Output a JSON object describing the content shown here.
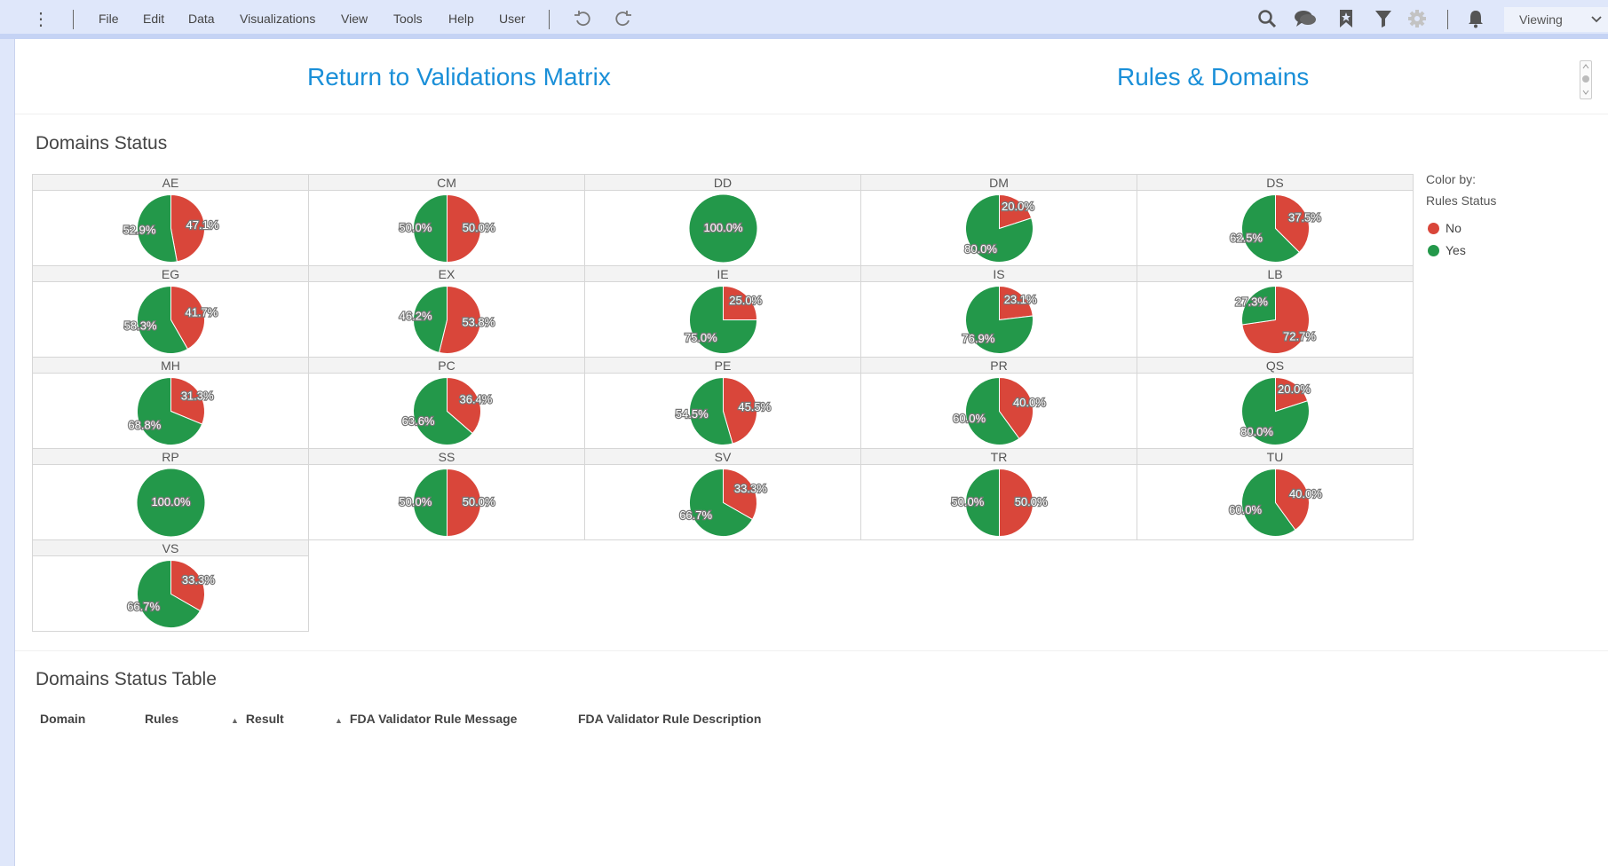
{
  "toolbar": {
    "menu": [
      "File",
      "Edit",
      "Data",
      "Visualizations",
      "View",
      "Tools",
      "Help",
      "User"
    ],
    "mode": "Viewing"
  },
  "header": {
    "return_link": "Return to Validations Matrix",
    "rules_link": "Rules & Domains"
  },
  "domains_status": {
    "title": "Domains Status",
    "legend": {
      "line1": "Color by:",
      "line2": "Rules Status",
      "items": [
        {
          "label": "No",
          "color": "#d9463a"
        },
        {
          "label": "Yes",
          "color": "#23984a"
        }
      ]
    }
  },
  "chart_data": {
    "type": "pie",
    "title": "Domains Status",
    "series_order": [
      "No",
      "Yes"
    ],
    "colors": {
      "No": "#d9463a",
      "Yes": "#23984a"
    },
    "panels": [
      {
        "domain": "AE",
        "no": 47.1,
        "yes": 52.9
      },
      {
        "domain": "CM",
        "no": 50.0,
        "yes": 50.0
      },
      {
        "domain": "DD",
        "no": 0,
        "yes": 100.0
      },
      {
        "domain": "DM",
        "no": 20.0,
        "yes": 80.0
      },
      {
        "domain": "DS",
        "no": 37.5,
        "yes": 62.5
      },
      {
        "domain": "EG",
        "no": 41.7,
        "yes": 58.3
      },
      {
        "domain": "EX",
        "no": 53.8,
        "yes": 46.2
      },
      {
        "domain": "IE",
        "no": 25.0,
        "yes": 75.0
      },
      {
        "domain": "IS",
        "no": 23.1,
        "yes": 76.9
      },
      {
        "domain": "LB",
        "no": 72.7,
        "yes": 27.3
      },
      {
        "domain": "MH",
        "no": 31.3,
        "yes": 68.8
      },
      {
        "domain": "PC",
        "no": 36.4,
        "yes": 63.6
      },
      {
        "domain": "PE",
        "no": 45.5,
        "yes": 54.5
      },
      {
        "domain": "PR",
        "no": 40.0,
        "yes": 60.0
      },
      {
        "domain": "QS",
        "no": 20.0,
        "yes": 80.0
      },
      {
        "domain": "RP",
        "no": 0,
        "yes": 100.0
      },
      {
        "domain": "SS",
        "no": 50.0,
        "yes": 50.0
      },
      {
        "domain": "SV",
        "no": 33.3,
        "yes": 66.7
      },
      {
        "domain": "TR",
        "no": 50.0,
        "yes": 50.0
      },
      {
        "domain": "TU",
        "no": 40.0,
        "yes": 60.0
      },
      {
        "domain": "VS",
        "no": 33.3,
        "yes": 66.7
      }
    ]
  },
  "table": {
    "title": "Domains Status Table",
    "columns": [
      "Domain",
      "Rules",
      "Result",
      "FDA Validator Rule Message",
      "FDA Validator Rule Description"
    ]
  }
}
